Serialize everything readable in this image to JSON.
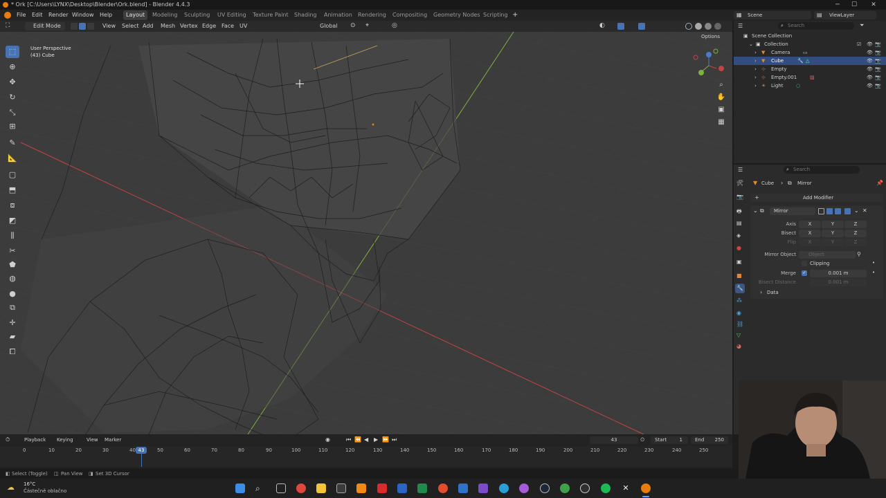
{
  "window": {
    "title": "* Ork [C:\\Users\\LYNX\\Desktop\\Blender\\Ork.blend] - Blender 4.4.3"
  },
  "menus": [
    "File",
    "Edit",
    "Render",
    "Window",
    "Help"
  ],
  "workspaces": [
    "Layout",
    "Modeling",
    "Sculpting",
    "UV Editing",
    "Texture Paint",
    "Shading",
    "Animation",
    "Rendering",
    "Compositing",
    "Geometry Nodes",
    "Scripting"
  ],
  "active_workspace": "Layout",
  "scene": {
    "name": "Scene",
    "view_layer": "ViewLayer"
  },
  "viewport_header": {
    "mode": "Edit Mode",
    "menus": [
      "View",
      "Select",
      "Add",
      "Mesh",
      "Vertex",
      "Edge",
      "Face",
      "UV"
    ],
    "transform_orientation": "Global",
    "options_label": "Options"
  },
  "viewport": {
    "perspective": "User Perspective",
    "object_info": "(43) Cube"
  },
  "outliner": {
    "search_placeholder": "Search",
    "root": "Scene Collection",
    "collection": "Collection",
    "items": [
      "Camera",
      "Cube",
      "Empty",
      "Empty.001",
      "Light"
    ],
    "selected": "Cube"
  },
  "properties": {
    "search_placeholder": "Search",
    "breadcrumb": [
      "Cube",
      "Mirror"
    ],
    "add_modifier_label": "Add Modifier",
    "modifier_name": "Mirror",
    "axis_label": "Axis",
    "bisect_label": "Bisect",
    "flip_label": "Flip",
    "axes": [
      "X",
      "Y",
      "Z"
    ],
    "mirror_object_label": "Mirror Object",
    "mirror_object_placeholder": "Object",
    "clipping_label": "Clipping",
    "merge_label": "Merge",
    "merge_value": "0.001 m",
    "bisect_distance_label": "Bisect Distance",
    "bisect_distance_value": "0.001 m",
    "data_label": "Data"
  },
  "timeline": {
    "menus": [
      "Playback",
      "Keying",
      "View",
      "Marker"
    ],
    "current_frame": "43",
    "start_label": "Start",
    "start": "1",
    "end_label": "End",
    "end": "250",
    "ruler": [
      "0",
      "10",
      "20",
      "30",
      "40",
      "43",
      "50",
      "60",
      "70",
      "80",
      "90",
      "100",
      "110",
      "120",
      "130",
      "140",
      "150",
      "160",
      "170",
      "180",
      "190",
      "200",
      "210",
      "220",
      "230",
      "240",
      "250"
    ]
  },
  "status_bar": {
    "hints": [
      "Select (Toggle)",
      "Pan View",
      "Set 3D Cursor"
    ]
  },
  "taskbar": {
    "weather_temp": "16°C",
    "weather_text": "Částečně oblačno"
  },
  "colors": {
    "accent": "#4772b3",
    "viewport_bg": "#3c3c3c",
    "x_axis": "#c44444",
    "y_axis": "#7fb23f",
    "selected_row": "#334d80"
  }
}
